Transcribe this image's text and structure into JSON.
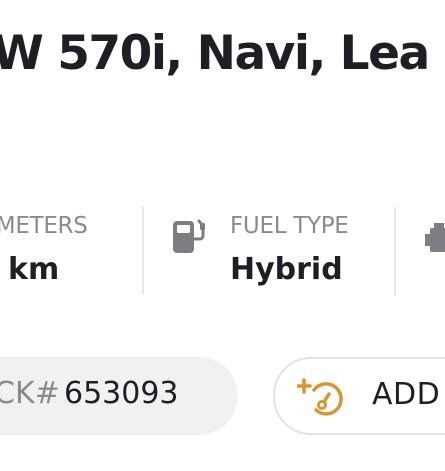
{
  "listing": {
    "title": "W 570i, Navi, Lea"
  },
  "specs": {
    "odometer": {
      "label": "OMETERS",
      "value": "km"
    },
    "fuel": {
      "label": "FUEL TYPE",
      "value": "Hybrid",
      "icon": "fuel-pump-icon"
    },
    "engine": {
      "icon": "engine-icon"
    }
  },
  "stock": {
    "label": "CK#",
    "number": "653093"
  },
  "actions": {
    "add_label": "ADD",
    "add_icon": "add-speedometer-icon"
  },
  "colors": {
    "title": "#1e1f25",
    "label_gray": "#8a8b8f",
    "accent": "#d9952f",
    "icon_gray": "#7d7e82",
    "pill_bg": "#f1f1f3"
  }
}
